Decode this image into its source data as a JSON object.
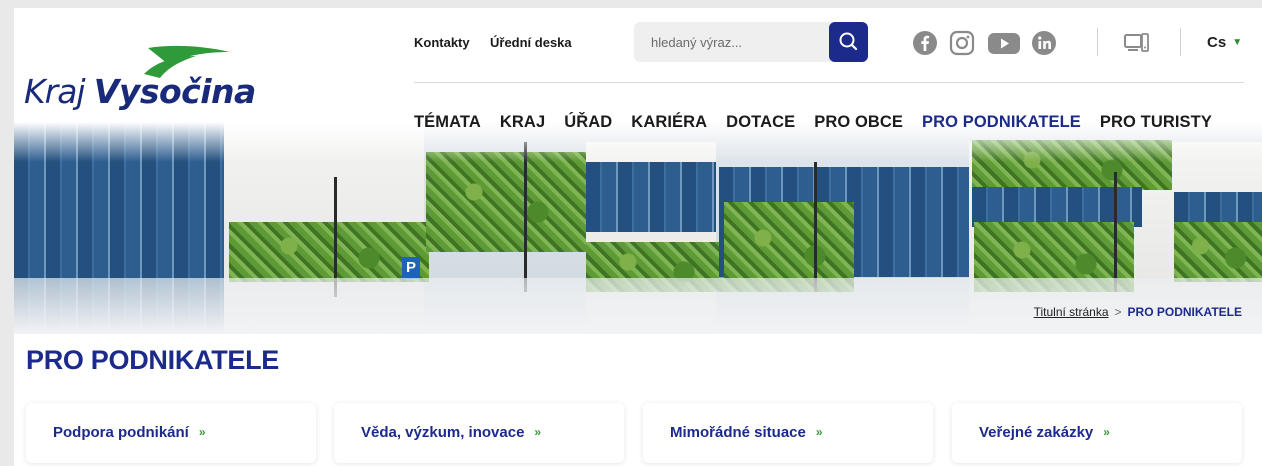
{
  "logo": {
    "text_light": "Kraj",
    "text_bold": "Vysočina"
  },
  "utility": {
    "links": [
      "Kontakty",
      "Úřední deska"
    ],
    "search_placeholder": "hledaný výraz...",
    "language": "Cs"
  },
  "social_icons": [
    "facebook-icon",
    "instagram-icon",
    "youtube-icon",
    "linkedin-icon"
  ],
  "mainnav": {
    "items": [
      "TÉMATA",
      "KRAJ",
      "ÚŘAD",
      "KARIÉRA",
      "DOTACE",
      "PRO OBCE",
      "PRO PODNIKATELE",
      "PRO TURISTY"
    ],
    "active": "PRO PODNIKATELE"
  },
  "breadcrumb": {
    "home": "Titulní stránka",
    "separator": ">",
    "current": "PRO PODNIKATELE"
  },
  "page": {
    "title": "PRO PODNIKATELE"
  },
  "cards": [
    "Podpora podnikání",
    "Věda, výzkum, inovace",
    "Mimořádné situace",
    "Veřejné zakázky"
  ],
  "colors": {
    "brand_blue": "#1c2b8b",
    "brand_green": "#3a9a3a",
    "background": "#e9e9e9"
  }
}
